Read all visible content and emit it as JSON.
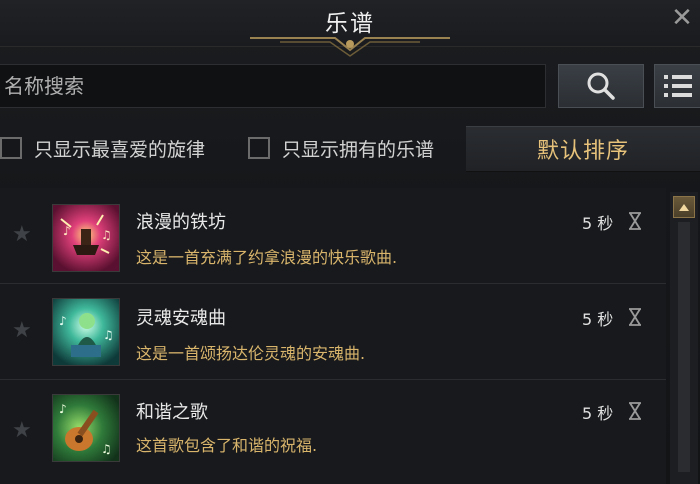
{
  "window": {
    "title": "乐谱"
  },
  "search": {
    "placeholder": "名称搜索"
  },
  "filters": {
    "favorites_label": "只显示最喜爱的旋律",
    "owned_label": "只显示拥有的乐谱",
    "sort_label": "默认排序"
  },
  "songs": [
    {
      "name": "浪漫的铁坊",
      "description": "这是一首充满了约拿浪漫的快乐歌曲.",
      "duration": "5 秒",
      "icon": "romantic-anvil-icon"
    },
    {
      "name": "灵魂安魂曲",
      "description": "这是一首颂扬达伦灵魂的安魂曲.",
      "duration": "5 秒",
      "icon": "soul-requiem-icon"
    },
    {
      "name": "和谐之歌",
      "description": "这首歌包含了和谐的祝福.",
      "duration": "5 秒",
      "icon": "harmony-guitar-icon"
    }
  ],
  "colors": {
    "accent_gold": "#d9b56c",
    "sort_text": "#e6c27a"
  }
}
